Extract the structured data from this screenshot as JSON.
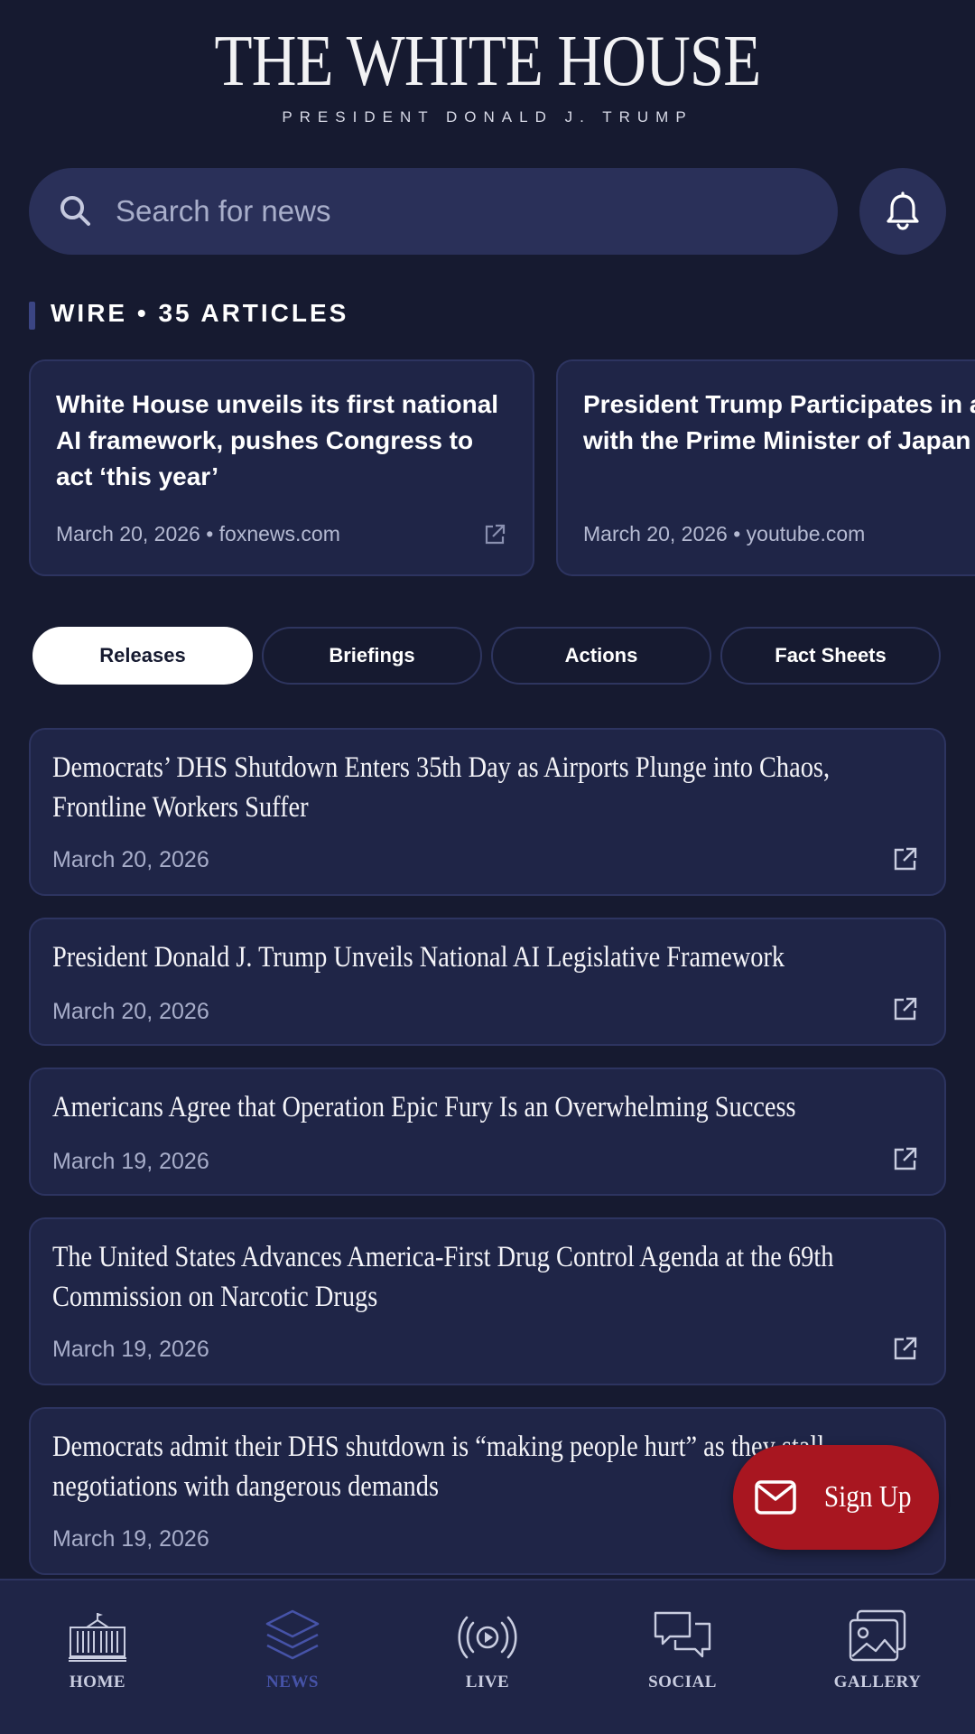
{
  "header": {
    "title": "THE WHITE HOUSE",
    "subtitle": "PRESIDENT DONALD J. TRUMP"
  },
  "search": {
    "placeholder": "Search for news",
    "icon": "search-icon"
  },
  "notifications": {
    "icon": "bell-icon"
  },
  "wire": {
    "label": "WIRE • 35 ARTICLES",
    "cards": [
      {
        "title": "White House unveils its first national AI framework, pushes Congress to act ‘this year’",
        "meta": "March 20, 2026 • foxnews.com"
      },
      {
        "title": "President Trump Participates in a Dinner with the Prime Minister of Japan",
        "meta": "March 20, 2026 • youtube.com"
      }
    ]
  },
  "tabs": [
    {
      "label": "Releases",
      "active": true
    },
    {
      "label": "Briefings",
      "active": false
    },
    {
      "label": "Actions",
      "active": false
    },
    {
      "label": "Fact Sheets",
      "active": false
    }
  ],
  "releases": [
    {
      "title": "Democrats’ DHS Shutdown Enters 35th Day as Airports Plunge into Chaos, Frontline Workers Suffer",
      "date": "March 20, 2026"
    },
    {
      "title": "President Donald J. Trump Unveils National AI Legislative Framework",
      "date": "March 20, 2026"
    },
    {
      "title": "Americans Agree that Operation Epic Fury Is an Overwhelming Success",
      "date": "March 19, 2026"
    },
    {
      "title": "The United States Advances America-First Drug Control Agenda at the 69th Commission on Narcotic Drugs",
      "date": "March 19, 2026"
    },
    {
      "title": "Democrats admit their DHS shutdown is “making people hurt” as they stall negotiations with dangerous demands",
      "date": "March 19, 2026"
    }
  ],
  "signup": {
    "label": "Sign Up",
    "icon": "mail-icon",
    "color": "#a81620"
  },
  "nav": [
    {
      "label": "HOME",
      "icon": "white-house-icon",
      "active": false
    },
    {
      "label": "NEWS",
      "icon": "layers-icon",
      "active": true
    },
    {
      "label": "LIVE",
      "icon": "live-broadcast-icon",
      "active": false
    },
    {
      "label": "SOCIAL",
      "icon": "chat-bubbles-icon",
      "active": false
    },
    {
      "label": "GALLERY",
      "icon": "gallery-icon",
      "active": false
    }
  ],
  "colors": {
    "background": "#161a30",
    "card": "#1f2547",
    "accent_active_nav": "#4653a8"
  }
}
